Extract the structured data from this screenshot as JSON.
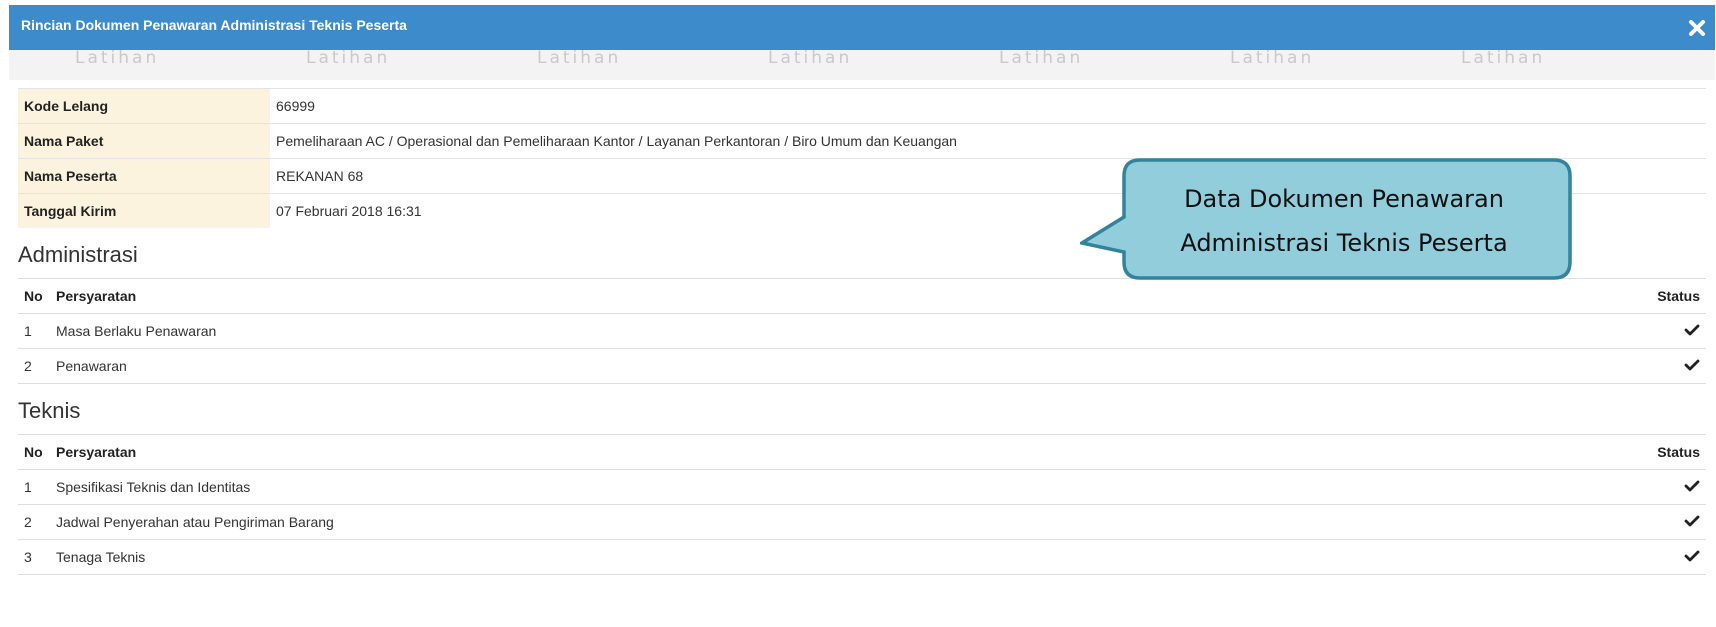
{
  "modal": {
    "title": "Rincian Dokumen Penawaran Administrasi Teknis Peserta",
    "close_icon": "close-icon",
    "watermark_text": "Latihan"
  },
  "info": [
    {
      "label": "Kode Lelang",
      "value": "66999"
    },
    {
      "label": "Nama Paket",
      "value": "Pemeliharaan AC / Operasional dan Pemeliharaan Kantor / Layanan Perkantoran / Biro Umum dan Keuangan"
    },
    {
      "label": "Nama Peserta",
      "value": "REKANAN 68"
    },
    {
      "label": "Tanggal Kirim",
      "value": "07 Februari 2018 16:31"
    }
  ],
  "administrasi": {
    "title": "Administrasi",
    "headers": {
      "no": "No",
      "persyaratan": "Persyaratan",
      "status": "Status"
    },
    "rows": [
      {
        "no": "1",
        "persyaratan": "Masa Berlaku Penawaran",
        "status_icon": "check-icon"
      },
      {
        "no": "2",
        "persyaratan": "Penawaran",
        "status_icon": "check-icon"
      }
    ]
  },
  "teknis": {
    "title": "Teknis",
    "headers": {
      "no": "No",
      "persyaratan": "Persyaratan",
      "status": "Status"
    },
    "rows": [
      {
        "no": "1",
        "persyaratan": "Spesifikasi Teknis dan Identitas",
        "status_icon": "check-icon"
      },
      {
        "no": "2",
        "persyaratan": "Jadwal Penyerahan atau Pengiriman Barang",
        "status_icon": "check-icon"
      },
      {
        "no": "3",
        "persyaratan": "Tenaga Teknis",
        "status_icon": "check-icon"
      }
    ]
  },
  "callout": {
    "line1": "Data Dokumen Penawaran",
    "line2": "Administrasi Teknis Peserta"
  },
  "colors": {
    "header_bg": "#3d8bca",
    "label_bg": "#fbf3dd",
    "callout_fill": "#92cddc",
    "callout_border": "#31849b"
  }
}
